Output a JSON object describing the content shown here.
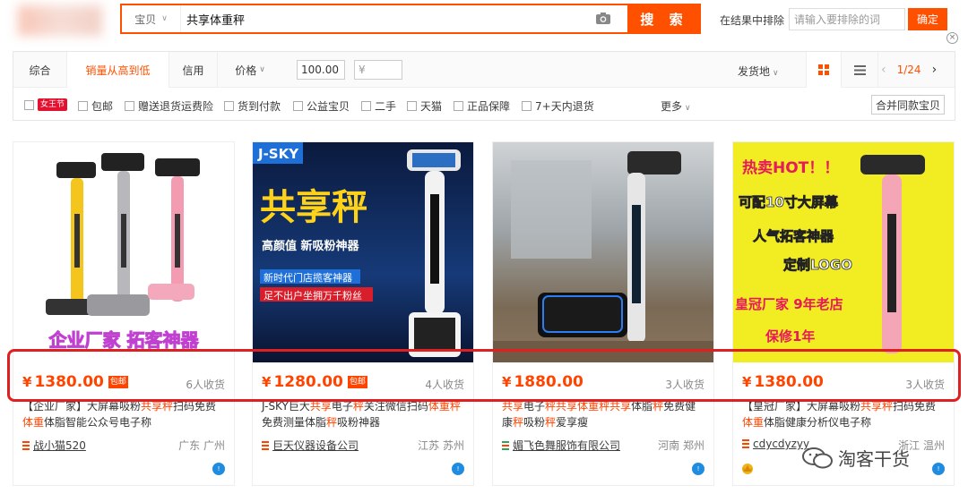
{
  "search": {
    "category": "宝贝",
    "query": "共享体重秤",
    "button": "搜 索",
    "exclude_label": "在结果中排除",
    "exclude_placeholder": "请输入要排除的词",
    "confirm": "确定"
  },
  "sort": {
    "tabs": [
      "综合",
      "销量从高到低",
      "信用",
      "价格"
    ],
    "active": "销量从高到低",
    "price_min": "100.00",
    "price_dash": "-",
    "price_max_placeholder": "¥",
    "ship_from": "发货地",
    "page": "1/24"
  },
  "filters": {
    "tmall_badge": "女王节",
    "items": [
      "包邮",
      "赠送退货运费险",
      "货到付款",
      "公益宝贝",
      "二手",
      "天猫",
      "正品保障",
      "7+天内退货"
    ],
    "more": "更多",
    "merge": "合并同款宝贝"
  },
  "products": [
    {
      "price": "1380.00",
      "baoyou": "包邮",
      "sold": "6人收货",
      "title_parts": [
        "【企业厂家】大屏幕吸粉",
        "共享秤",
        "扫码免费",
        "体",
        "重",
        "体脂智能公众号电子称"
      ],
      "shop": "战小猫520",
      "location": "广东 广州",
      "img_text": "企业厂家  拓客神器"
    },
    {
      "price": "1280.00",
      "baoyou": "包邮",
      "sold": "4人收货",
      "title_parts": [
        "J-SKY巨大",
        "共享",
        "电子",
        "秤",
        "关注微信扫码",
        "体重秤",
        "免费测量体脂",
        "秤",
        "吸粉神器"
      ],
      "shop": "巨天仪器设备公司",
      "location": "江苏 苏州",
      "img_brand": "J-SKY",
      "img_title": "共享秤",
      "img_line1": "高颜值  新吸粉神器",
      "img_line2": "新时代门店揽客神器",
      "img_line3": "足不出户坐拥万千粉丝"
    },
    {
      "price": "1880.00",
      "baoyou": "",
      "sold": "3人收货",
      "title_parts": [
        "共享",
        "电子",
        "秤",
        "共享",
        "体重秤",
        "共享",
        "体脂",
        "秤",
        "免费健康",
        "秤",
        "吸粉",
        "秤",
        "爱享瘦"
      ],
      "shop": "媚飞色舞服饰有限公司",
      "location": "河南 郑州"
    },
    {
      "price": "1380.00",
      "baoyou": "",
      "sold": "3人收货",
      "title_parts": [
        "【皇冠厂家】大屏幕吸粉",
        "共享秤",
        "扫码免费",
        "体",
        "重",
        "体脂健康分析仪电子称"
      ],
      "shop": "cdycdyzyy",
      "location": "浙江 温州",
      "img_hot": "热卖HOT！！",
      "img_line1": "可配10寸大屏幕",
      "img_line2": "人气拓客神器",
      "img_line3": "定制LOGO",
      "img_line4": "皇冠厂家 9年老店",
      "img_line5": "保修1年"
    }
  ],
  "watermark": "淘客干货"
}
